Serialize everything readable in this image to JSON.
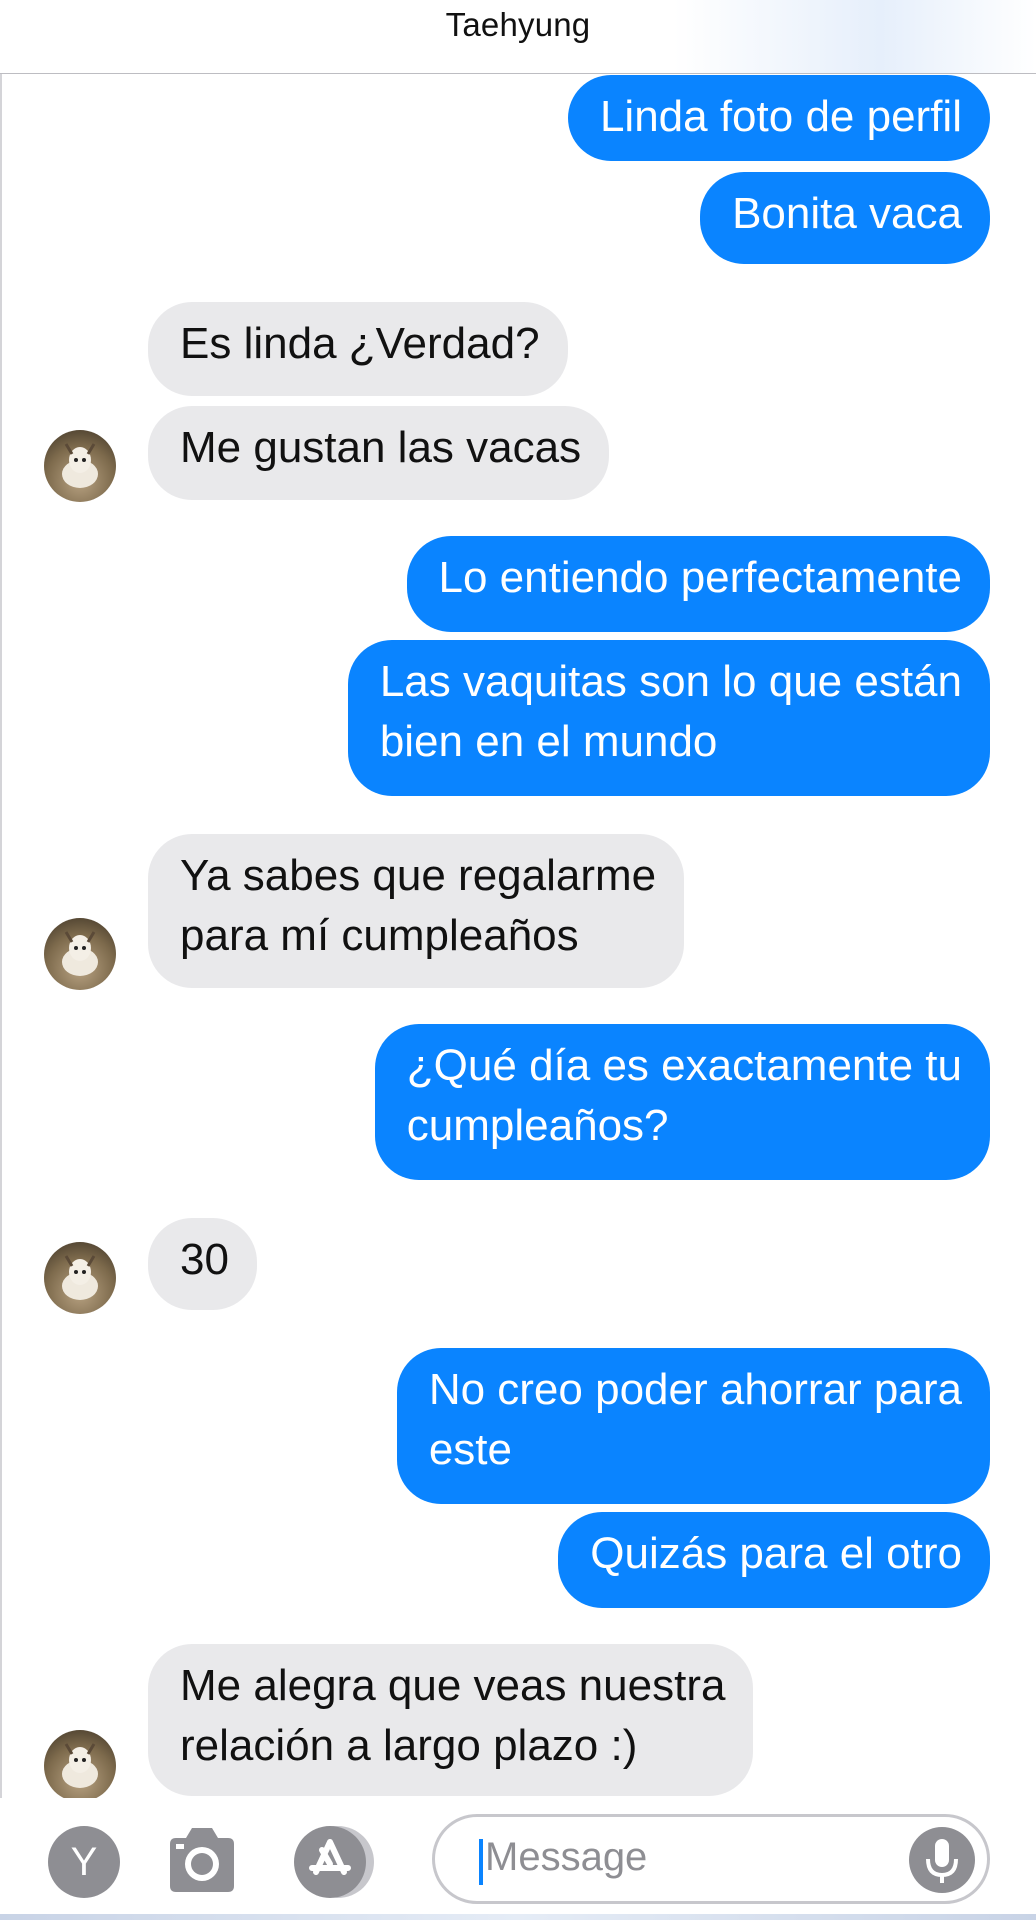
{
  "header": {
    "title": "Taehyung"
  },
  "messages": [
    {
      "from": "me",
      "text": "Linda foto de perfil"
    },
    {
      "from": "me",
      "text": "Bonita vaca"
    },
    {
      "from": "them",
      "text": "Es linda ¿Verdad?"
    },
    {
      "from": "them",
      "text": "Me gustan las vacas"
    },
    {
      "from": "me",
      "text": "Lo entiendo perfectamente"
    },
    {
      "from": "me",
      "text": "Las vaquitas son lo que están\nbien en el mundo"
    },
    {
      "from": "them",
      "text": "Ya sabes que regalarme\npara mí cumpleaños"
    },
    {
      "from": "me",
      "text": "¿Qué día es exactamente tu\ncumpleaños?"
    },
    {
      "from": "them",
      "text": "30"
    },
    {
      "from": "me",
      "text": " No creo poder ahorrar para\neste"
    },
    {
      "from": "me",
      "text": "Quizás para el otro"
    },
    {
      "from": "them",
      "text": "Me alegra que veas nuestra\nrelación a largo plazo :)"
    }
  ],
  "composer": {
    "app_button_label": "Y",
    "placeholder": "Message",
    "icons": [
      "camera-icon",
      "app-store-icon",
      "microphone-icon"
    ]
  },
  "colors": {
    "outgoing_bubble": "#0a84ff",
    "incoming_bubble": "#e9e9eb",
    "icon_gray": "#8e8e93"
  }
}
